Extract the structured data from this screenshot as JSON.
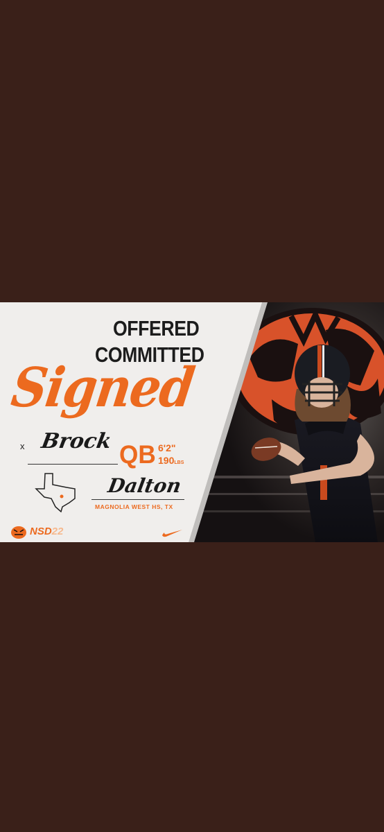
{
  "graphic": {
    "headline_line1": "OFFERED",
    "headline_line2": "COMMITTED",
    "headline_script": "Signed",
    "x_mark": "x",
    "first_name": "Brock",
    "last_name": "Dalton",
    "position": "QB",
    "height": "6'2\"",
    "weight_value": "190",
    "weight_unit": "LBS",
    "school": "MAGNOLIA WEST HS, TX",
    "event_prefix": "NSD",
    "event_year": "22"
  },
  "colors": {
    "background": "#3a2019",
    "accent_orange": "#ec6a1f",
    "panel_light": "#f0eeec",
    "dark_text": "#1c1c1c"
  },
  "icons": [
    "texas-map-icon",
    "tiger-logo-icon",
    "swoosh-logo-icon",
    "football-player-photo"
  ]
}
